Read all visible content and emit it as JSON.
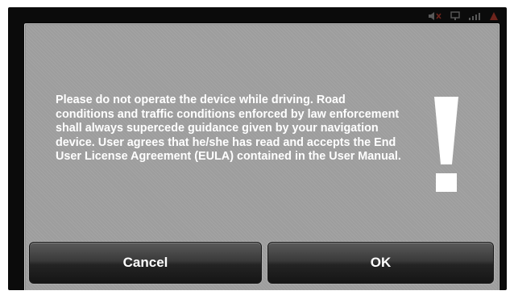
{
  "dialog": {
    "message": "Please do not operate the device while driving. Road conditions and traffic conditions enforced by law enforcement shall always supercede guidance given by your navigation device. User agrees that he/she has read and accepts the End User License Agreement (EULA) contained in the User Manual.",
    "icon": "exclamation-icon"
  },
  "buttons": {
    "cancel_label": "Cancel",
    "ok_label": "OK"
  },
  "status_bar": {
    "icons": [
      "volume-muted-icon",
      "gps-icon",
      "signal-icon",
      "alert-icon"
    ]
  },
  "colors": {
    "dialog_background": "#9d9d9d",
    "frame_background": "#0b0b0b",
    "text": "#ffffff",
    "button_top": "#5a5a5a",
    "button_bottom": "#151515",
    "alert_accent": "#c0392b"
  }
}
